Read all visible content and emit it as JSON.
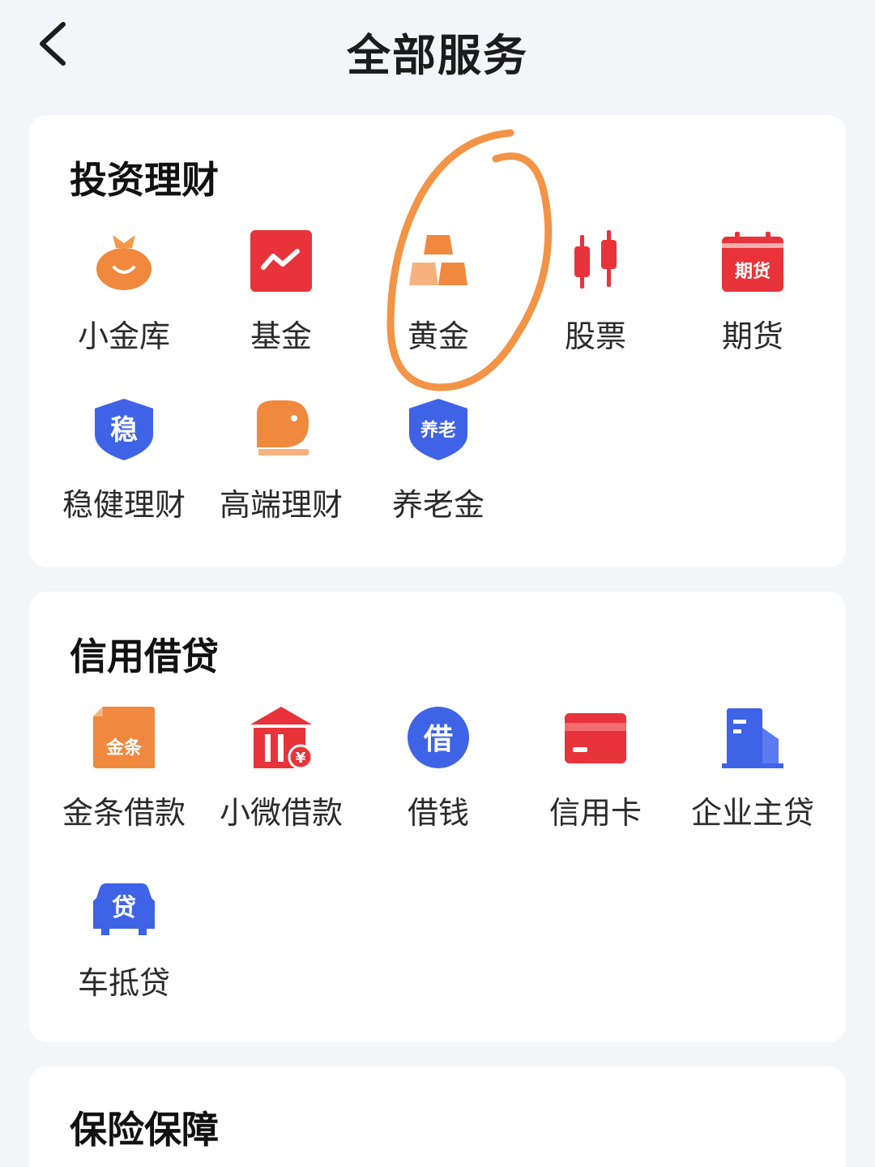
{
  "header": {
    "title": "全部服务"
  },
  "sections": [
    {
      "title": "投资理财",
      "items": [
        {
          "label": "小金库",
          "icon": "money-bag-icon",
          "glyph": ""
        },
        {
          "label": "基金",
          "icon": "fund-chart-icon",
          "glyph": ""
        },
        {
          "label": "黄金",
          "icon": "gold-bars-icon",
          "glyph": ""
        },
        {
          "label": "股票",
          "icon": "candlestick-icon",
          "glyph": ""
        },
        {
          "label": "期货",
          "icon": "futures-calendar-icon",
          "glyph": "期货"
        },
        {
          "label": "稳健理财",
          "icon": "steady-shield-icon",
          "glyph": "稳"
        },
        {
          "label": "高端理财",
          "icon": "premium-wealth-icon",
          "glyph": ""
        },
        {
          "label": "养老金",
          "icon": "pension-shield-icon",
          "glyph": "养老"
        }
      ]
    },
    {
      "title": "信用借贷",
      "items": [
        {
          "label": "金条借款",
          "icon": "gold-strip-icon",
          "glyph": "金条"
        },
        {
          "label": "小微借款",
          "icon": "bank-yuan-icon",
          "glyph": "¥"
        },
        {
          "label": "借钱",
          "icon": "borrow-circle-icon",
          "glyph": "借"
        },
        {
          "label": "信用卡",
          "icon": "credit-card-icon",
          "glyph": ""
        },
        {
          "label": "企业主贷",
          "icon": "building-icon",
          "glyph": ""
        },
        {
          "label": "车抵贷",
          "icon": "car-loan-icon",
          "glyph": "贷"
        }
      ]
    },
    {
      "title": "保险保障",
      "items": []
    }
  ],
  "colors": {
    "background": "#f4f5f9",
    "card": "#ffffff",
    "orange": "#f0883e",
    "red": "#e8333a",
    "blue": "#3f63e6",
    "annotation": "#f28a35"
  }
}
